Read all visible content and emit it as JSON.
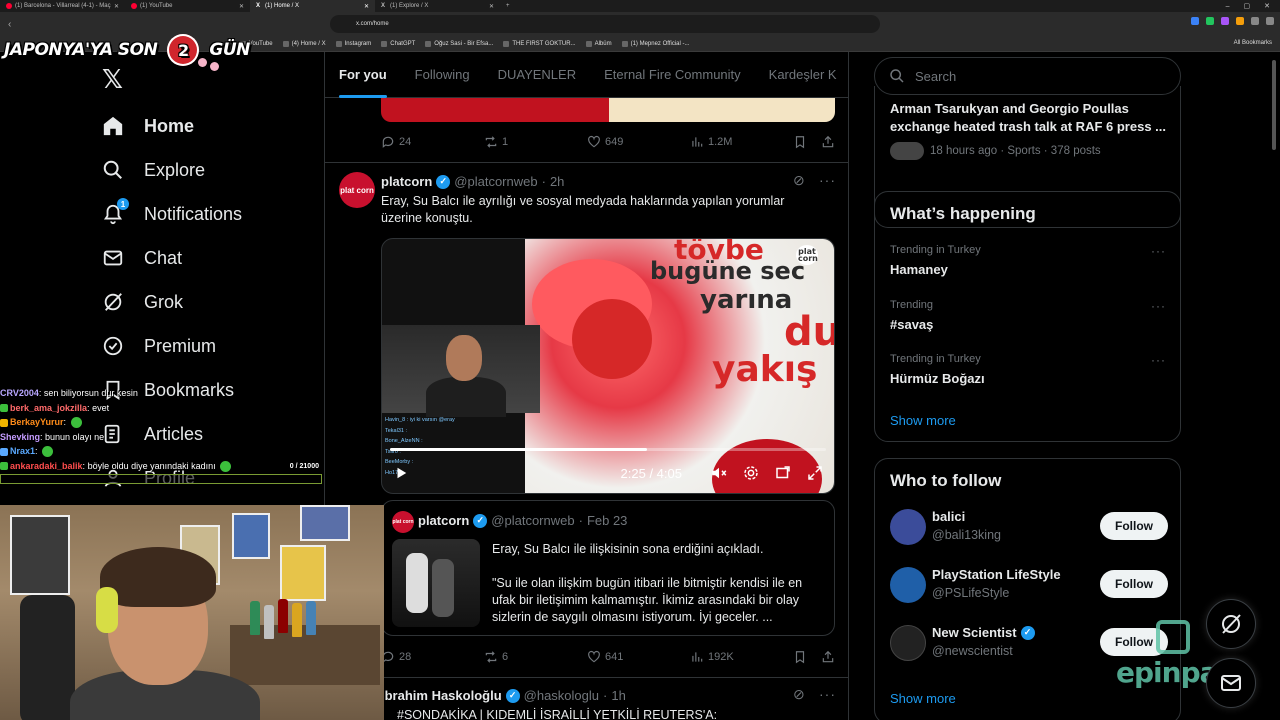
{
  "browser": {
    "tabs": [
      {
        "label": "(1) Barcelona - Villarreal (4-1) - Maç",
        "active": false
      },
      {
        "label": "(1) YouTube",
        "active": false
      },
      {
        "label": "(1) Home / X",
        "active": true
      },
      {
        "label": "(1) Explore / X",
        "active": false
      }
    ],
    "url": "x.com/home",
    "bookmarks": [
      "YouTube",
      "(4) Home / X",
      "Instagram",
      "ChatGPT",
      "Oğuz Sasi - Bir Efsa...",
      "THE FIRST GOKTUR...",
      "Albüm",
      "(1) Mepnez Official -..."
    ],
    "all_bookmarks": "All Bookmarks"
  },
  "banner": {
    "left": "JAPONYA'YA SON",
    "number": "2",
    "right": "GÜN"
  },
  "sidebar": {
    "items": [
      {
        "label": "Home",
        "icon": "home-icon"
      },
      {
        "label": "Explore",
        "icon": "search-icon"
      },
      {
        "label": "Notifications",
        "icon": "bell-icon",
        "badge": "1"
      },
      {
        "label": "Chat",
        "icon": "mail-icon"
      },
      {
        "label": "Grok",
        "icon": "grok-icon"
      },
      {
        "label": "Premium",
        "icon": "premium-icon"
      },
      {
        "label": "Bookmarks",
        "icon": "bookmark-icon"
      },
      {
        "label": "Articles",
        "icon": "articles-icon"
      },
      {
        "label": "Profile",
        "icon": "profile-icon"
      }
    ]
  },
  "chat_overlay": {
    "lines": [
      {
        "user": "CRV2004",
        "user_color": "#b9a7ff",
        "message": "sen biliyorsun dur kesin"
      },
      {
        "user": "berk_ama_jokzilla",
        "user_color": "#ff6a6a",
        "message": "evet"
      },
      {
        "user": "BerkayYurur",
        "user_color": "#ff8c1a",
        "message": ""
      },
      {
        "user": "Shevking",
        "user_color": "#c59cff",
        "message": "bunun olayı ne"
      },
      {
        "user": "Nrax1",
        "user_color": "#5aa9ff",
        "message": ""
      },
      {
        "user": "ankaradaki_balik",
        "user_color": "#ff4d4d",
        "message": "böyle oldu diye yanındaki kadını"
      }
    ],
    "progress": {
      "label": "0 / 21000",
      "fraction": 0.0
    }
  },
  "feed": {
    "tabs": [
      "For you",
      "Following",
      "DUAYENLER",
      "Eternal Fire Community",
      "Kardeşler K"
    ],
    "prev_actions": {
      "replies": "24",
      "reposts": "1",
      "likes": "649",
      "views": "1.2M"
    },
    "tweet1": {
      "name": "platcorn",
      "handle": "@platcornweb",
      "time": "2h",
      "text": "Eray, Su Balcı ile ayrılığı ve sosyal medyada haklarında yapılan yorumlar üzerine konuştu.",
      "video": {
        "overlay_lines": [
          "tövbe",
          "bugüne sec",
          "yarına",
          "du",
          "yakış"
        ],
        "watermark": "plat corn",
        "mini_chat": [
          "Havin_8 : iyi ki varsın @eray",
          "Tekal31 :",
          "Bone_AlzeNN :",
          "Tsiiro :",
          "BeeMorby :",
          "Ho17 :"
        ],
        "current_time": "2:25",
        "duration": "4:05",
        "time_display": "2:25 / 4:05",
        "progress_fraction": 0.59
      },
      "quote": {
        "name": "platcorn",
        "handle": "@platcornweb",
        "date": "Feb 23",
        "text1": "Eray, Su Balcı ile ilişkisinin sona erdiğini açıkladı.",
        "text2": "\"Su ile olan ilişkim bugün itibari ile bitmiştir kendisi ile en ufak bir iletişimim kalmamıştır. İkimiz arasındaki bir olay sizlerin de saygılı olmasını istiyorum. İyi geceler. ..."
      },
      "actions": {
        "replies": "28",
        "reposts": "6",
        "likes": "641",
        "views": "192K"
      }
    },
    "tweet2": {
      "name": "İbrahim Haskoloğlu",
      "handle": "@haskologlu",
      "time": "1h",
      "text": "#SONDAKİKA | KIDEMLİ İSRAİLLİ YETKİLİ REUTERS'A:"
    }
  },
  "right": {
    "search_placeholder": "Search",
    "top_story": {
      "title": "Arman Tsarukyan and Georgio Poullas exchange heated trash talk at RAF 6 press ...",
      "meta": "18 hours ago · Sports · 378 posts"
    },
    "happening": {
      "title": "What’s happening",
      "trends": [
        {
          "meta": "Trending in Turkey",
          "name": "Hamaney"
        },
        {
          "meta": "Trending",
          "name": "#savaş"
        },
        {
          "meta": "Trending in Turkey",
          "name": "Hürmüz Boğazı"
        }
      ],
      "show_more": "Show more"
    },
    "who_to_follow": {
      "title": "Who to follow",
      "accounts": [
        {
          "name": "balici",
          "handle": "@bali13king",
          "verified": false,
          "button": "Follow",
          "avatar_color": "#3b4c9a"
        },
        {
          "name": "PlayStation LifeStyle",
          "handle": "@PSLifeStyle",
          "verified": false,
          "button": "Follow",
          "avatar_color": "#1f5fa8"
        },
        {
          "name": "New Scientist",
          "handle": "@newscientist",
          "verified": true,
          "button": "Follow",
          "avatar_color": "#222222"
        }
      ],
      "show_more": "Show more"
    }
  },
  "overlay": {
    "sponsor": "epinpay"
  },
  "colors": {
    "accent": "#1d9bf0",
    "text": "#e7e9ea",
    "muted": "#71767b",
    "border": "#2f3336",
    "sponsor": "#5fc2a6"
  }
}
